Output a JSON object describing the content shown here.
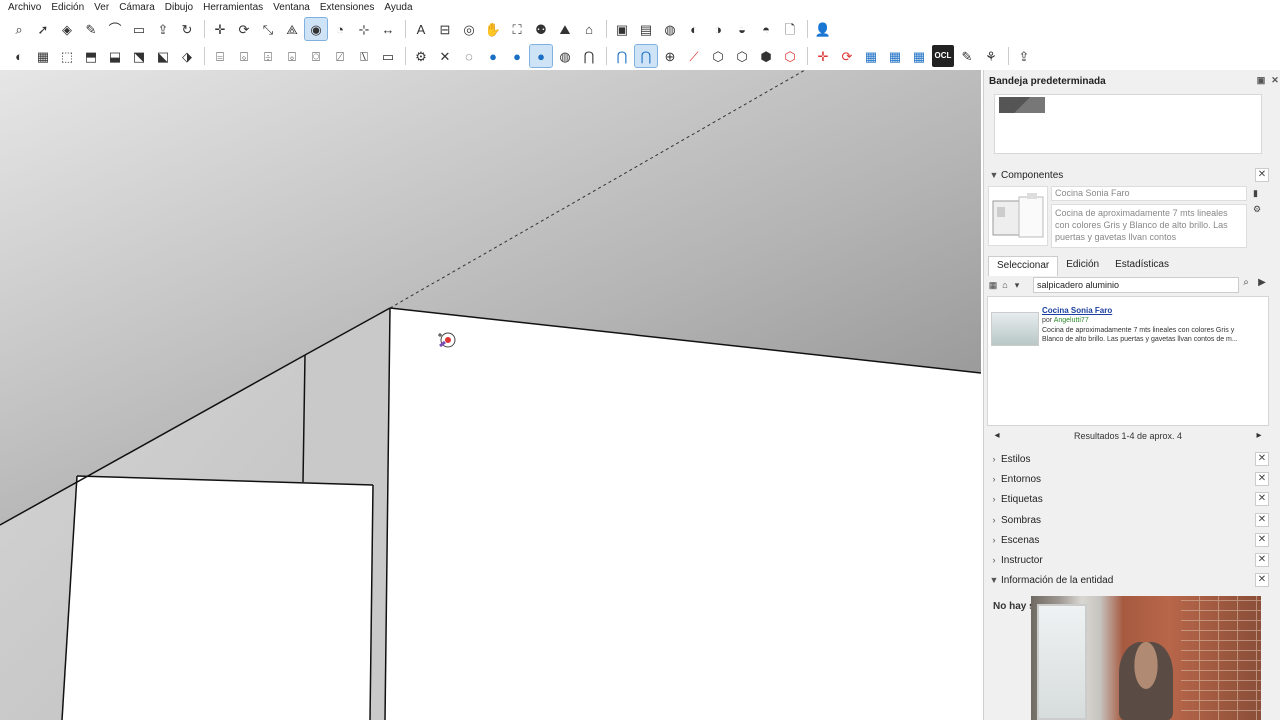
{
  "menu": {
    "items": [
      "Archivo",
      "Edición",
      "Ver",
      "Cámara",
      "Dibujo",
      "Herramientas",
      "Ventana",
      "Extensiones",
      "Ayuda"
    ]
  },
  "toolbar1": {
    "tools": [
      {
        "icon": "zoom-icon",
        "glyph": "⌕"
      },
      {
        "icon": "select-icon",
        "glyph": "➚"
      },
      {
        "icon": "eraser-icon",
        "glyph": "◈"
      },
      {
        "icon": "pencil-icon",
        "glyph": "✎"
      },
      {
        "icon": "arc-icon",
        "glyph": "⌒"
      },
      {
        "icon": "rectangle-icon",
        "glyph": "▭"
      },
      {
        "icon": "push-pull-icon",
        "glyph": "⇪"
      },
      {
        "icon": "follow-me-icon",
        "glyph": "↻"
      },
      {
        "icon": "move-icon",
        "glyph": "✛"
      },
      {
        "icon": "rotate-icon",
        "glyph": "⟳"
      },
      {
        "icon": "scale-icon",
        "glyph": "⤡"
      },
      {
        "icon": "offset-icon",
        "glyph": "⟁"
      },
      {
        "icon": "tape-measure-icon",
        "glyph": "◉",
        "active": true
      },
      {
        "icon": "protractor-icon",
        "glyph": "◔"
      },
      {
        "icon": "axes-icon",
        "glyph": "⊹"
      },
      {
        "icon": "dimension-icon",
        "glyph": "↔"
      },
      {
        "icon": "text-icon",
        "glyph": "A"
      },
      {
        "icon": "section-plane-icon",
        "glyph": "⊟"
      },
      {
        "icon": "orbit-icon",
        "glyph": "◎"
      },
      {
        "icon": "pan-icon",
        "glyph": "✋"
      },
      {
        "icon": "zoom-extents-icon",
        "glyph": "⛶"
      },
      {
        "icon": "walk-icon",
        "glyph": "⚉"
      },
      {
        "icon": "sandbox-icon",
        "glyph": "⛰"
      },
      {
        "icon": "warehouse-icon",
        "glyph": "⌂"
      },
      {
        "icon": "extension-warehouse-icon",
        "glyph": "▣"
      },
      {
        "icon": "layout-icon",
        "glyph": "▤"
      },
      {
        "icon": "solid-union-icon",
        "glyph": "◍"
      },
      {
        "icon": "solid-intersect-icon",
        "glyph": "◐"
      },
      {
        "icon": "solid-trim-icon",
        "glyph": "◑"
      },
      {
        "icon": "solid-split-icon",
        "glyph": "◒"
      },
      {
        "icon": "outer-shell-icon",
        "glyph": "◓"
      },
      {
        "icon": "new-file-icon",
        "glyph": "🗋"
      },
      {
        "icon": "user-icon",
        "glyph": "👤"
      }
    ]
  },
  "toolbar2": {
    "tools": [
      {
        "icon": "styles-icon",
        "glyph": "◐"
      },
      {
        "icon": "xray-icon",
        "glyph": "▦"
      },
      {
        "icon": "wireframe-icon",
        "glyph": "⬚"
      },
      {
        "icon": "hidden-line-icon",
        "glyph": "⬒"
      },
      {
        "icon": "shaded-icon",
        "glyph": "⬓"
      },
      {
        "icon": "textured-icon",
        "glyph": "⬔"
      },
      {
        "icon": "monochrome-icon",
        "glyph": "⬕"
      },
      {
        "icon": "iso-view-icon",
        "glyph": "⬗"
      },
      {
        "icon": "top-view-icon",
        "glyph": "⌸"
      },
      {
        "icon": "front-view-icon",
        "glyph": "⌺"
      },
      {
        "icon": "right-view-icon",
        "glyph": "⌹"
      },
      {
        "icon": "back-view-icon",
        "glyph": "⌻"
      },
      {
        "icon": "left-view-icon",
        "glyph": "⌼"
      },
      {
        "icon": "section-fill-icon",
        "glyph": "⍁"
      },
      {
        "icon": "section-cut-icon",
        "glyph": "⍂"
      },
      {
        "icon": "rectangle-select-icon",
        "glyph": "▭"
      },
      {
        "icon": "gear-icon",
        "glyph": "⚙"
      },
      {
        "icon": "close-icon",
        "glyph": "✕"
      },
      {
        "icon": "drop-outline-icon",
        "glyph": "◌"
      },
      {
        "icon": "drop-blue-icon",
        "glyph": "●",
        "color": "blue"
      },
      {
        "icon": "drop-blue-filled-icon",
        "glyph": "●",
        "color": "blue"
      },
      {
        "icon": "drop-active-icon",
        "glyph": "●",
        "color": "blue",
        "active": true
      },
      {
        "icon": "drop-gray-icon",
        "glyph": "◍"
      },
      {
        "icon": "magnet-icon",
        "glyph": "⋂"
      },
      {
        "icon": "magnet-blue-icon",
        "glyph": "⋂",
        "color": "blue"
      },
      {
        "icon": "magnet-active-icon",
        "glyph": "⋂",
        "color": "blue",
        "active": true
      },
      {
        "icon": "add-circle-icon",
        "glyph": "⊕"
      },
      {
        "icon": "line-tool-icon",
        "glyph": "⟋",
        "color": "red"
      },
      {
        "icon": "hex-icon",
        "glyph": "⬡"
      },
      {
        "icon": "hex-2-icon",
        "glyph": "⬡"
      },
      {
        "icon": "hex-3-icon",
        "glyph": "⬢"
      },
      {
        "icon": "hex-red-icon",
        "glyph": "⬡",
        "color": "red"
      },
      {
        "icon": "cross-red-icon",
        "glyph": "✛",
        "color": "red"
      },
      {
        "icon": "refresh-red-icon",
        "glyph": "⟳",
        "color": "red"
      },
      {
        "icon": "grid-icon",
        "glyph": "▦",
        "color": "blue"
      },
      {
        "icon": "grid-2-icon",
        "glyph": "▦",
        "color": "blue"
      },
      {
        "icon": "grid-3-icon",
        "glyph": "▦",
        "color": "blue"
      },
      {
        "icon": "ocl-icon",
        "glyph": "OCL"
      },
      {
        "icon": "brush-icon",
        "glyph": "✎"
      },
      {
        "icon": "tree-icon",
        "glyph": "⚘"
      },
      {
        "icon": "export-icon",
        "glyph": "⇪"
      }
    ]
  },
  "tray": {
    "title": "Bandeja predeterminada",
    "components": {
      "header": "Componentes",
      "name": "Cocina Sonia Faro",
      "description": "Cocina de aproximadamente 7 mts lineales con colores Gris y Blanco de alto brillo. Las puertas y gavetas llvan contos",
      "tabs": [
        "Seleccionar",
        "Edición",
        "Estadísticas"
      ],
      "search_value": "salpicadero aluminio",
      "result": {
        "title": "Cocina Sonia Faro",
        "author_prefix": "por",
        "author": "Angelutti77",
        "description": "Cocina de aproximadamente 7 mts lineales con colores Gris y Blanco de alto brillo. Las puertas y gavetas llvan contos de m..."
      },
      "results_text": "Resultados 1-4 de aprox. 4"
    },
    "panels": [
      "Estilos",
      "Entornos",
      "Etiquetas",
      "Sombras",
      "Escenas",
      "Instructor",
      "Información de la entidad"
    ],
    "entity_info": {
      "text": "No hay s"
    }
  }
}
